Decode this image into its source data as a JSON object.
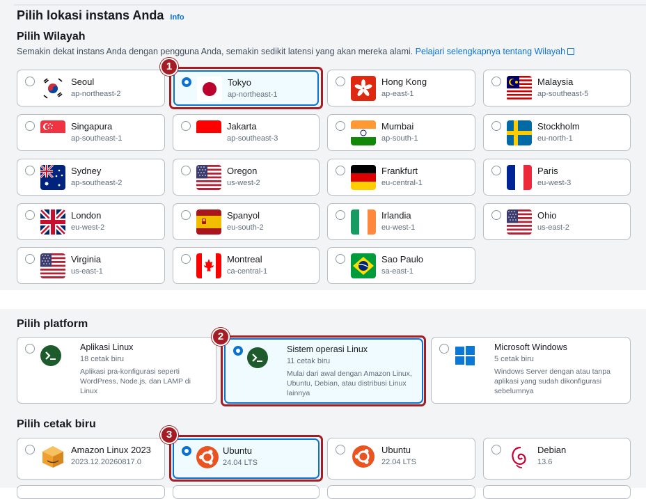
{
  "header": {
    "title": "Pilih lokasi instans Anda",
    "info_link": "Info"
  },
  "region_section": {
    "title": "Pilih Wilayah",
    "description": "Semakin dekat instans Anda dengan pengguna Anda, semakin sedikit latensi yang akan mereka alami.",
    "learn_more": "Pelajari selengkapnya tentang Wilayah",
    "selected": "Tokyo",
    "regions": [
      {
        "name": "Seoul",
        "code": "ap-northeast-2",
        "flag": "south-korea-flag"
      },
      {
        "name": "Tokyo",
        "code": "ap-northeast-1",
        "flag": "japan-flag"
      },
      {
        "name": "Hong Kong",
        "code": "ap-east-1",
        "flag": "hong-kong-flag"
      },
      {
        "name": "Malaysia",
        "code": "ap-southeast-5",
        "flag": "malaysia-flag"
      },
      {
        "name": "Singapura",
        "code": "ap-southeast-1",
        "flag": "singapore-flag"
      },
      {
        "name": "Jakarta",
        "code": "ap-southeast-3",
        "flag": "indonesia-flag"
      },
      {
        "name": "Mumbai",
        "code": "ap-south-1",
        "flag": "india-flag"
      },
      {
        "name": "Stockholm",
        "code": "eu-north-1",
        "flag": "sweden-flag"
      },
      {
        "name": "Sydney",
        "code": "ap-southeast-2",
        "flag": "australia-flag"
      },
      {
        "name": "Oregon",
        "code": "us-west-2",
        "flag": "usa-flag"
      },
      {
        "name": "Frankfurt",
        "code": "eu-central-1",
        "flag": "germany-flag"
      },
      {
        "name": "Paris",
        "code": "eu-west-3",
        "flag": "france-flag"
      },
      {
        "name": "London",
        "code": "eu-west-2",
        "flag": "uk-flag"
      },
      {
        "name": "Spanyol",
        "code": "eu-south-2",
        "flag": "spain-flag"
      },
      {
        "name": "Irlandia",
        "code": "eu-west-1",
        "flag": "ireland-flag"
      },
      {
        "name": "Ohio",
        "code": "us-east-2",
        "flag": "usa-flag"
      },
      {
        "name": "Virginia",
        "code": "us-east-1",
        "flag": "usa-flag"
      },
      {
        "name": "Montreal",
        "code": "ca-central-1",
        "flag": "canada-flag"
      },
      {
        "name": "Sao Paulo",
        "code": "sa-east-1",
        "flag": "brazil-flag"
      }
    ]
  },
  "platform_section": {
    "title": "Pilih platform",
    "selected": "Sistem operasi Linux",
    "platforms": [
      {
        "name": "Aplikasi Linux",
        "count": "18 cetak biru",
        "desc": "Aplikasi pra-konfigurasi seperti WordPress, Node.js, dan LAMP di Linux",
        "icon": "terminal-icon"
      },
      {
        "name": "Sistem operasi Linux",
        "count": "11 cetak biru",
        "desc": "Mulai dari awal dengan Amazon Linux, Ubuntu, Debian, atau distribusi Linux lainnya",
        "icon": "terminal-icon"
      },
      {
        "name": "Microsoft Windows",
        "count": "5 cetak biru",
        "desc": "Windows Server dengan atau tanpa aplikasi yang sudah dikonfigurasi sebelumnya",
        "icon": "windows-logo-icon"
      }
    ]
  },
  "blueprint_section": {
    "title": "Pilih cetak biru",
    "selected": "Ubuntu 24.04 LTS",
    "blueprints": [
      {
        "name": "Amazon Linux 2023",
        "version": "2023.12.20260817.0",
        "icon": "amazon-linux-icon"
      },
      {
        "name": "Ubuntu",
        "version": "24.04 LTS",
        "icon": "ubuntu-logo-icon"
      },
      {
        "name": "Ubuntu",
        "version": "22.04 LTS",
        "icon": "ubuntu-logo-icon"
      },
      {
        "name": "Debian",
        "version": "13.6",
        "icon": "debian-logo-icon"
      }
    ]
  },
  "step_badges": [
    "1",
    "2",
    "3"
  ],
  "colors": {
    "selection": "#0972d3",
    "highlight": "#a51d24",
    "panel": "#f3f4f6"
  }
}
